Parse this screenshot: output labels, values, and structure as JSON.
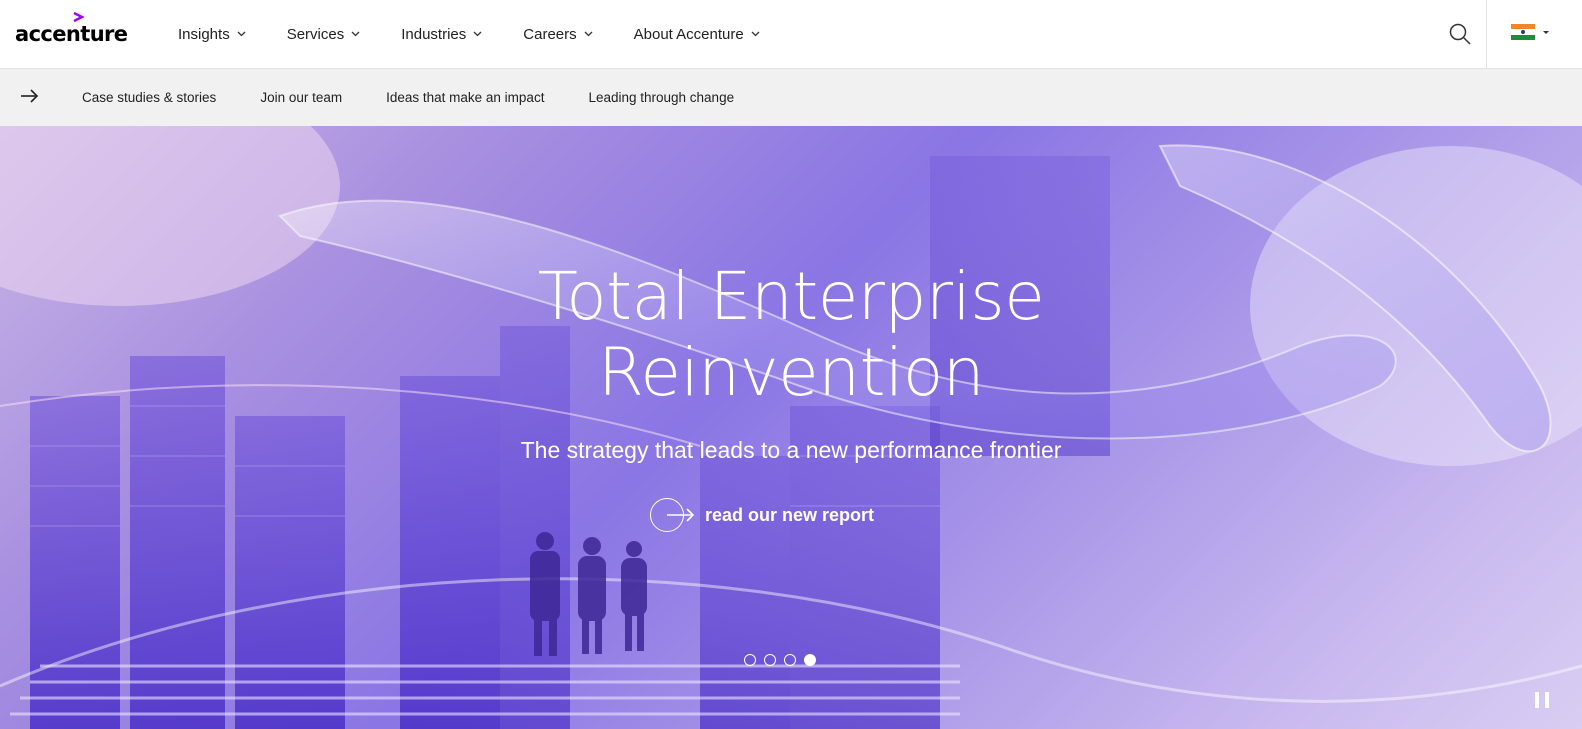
{
  "brand": {
    "name": "accenture",
    "accent_color": "#a100ff"
  },
  "nav": {
    "items": [
      {
        "label": "Insights",
        "icon": "chevron-down-icon"
      },
      {
        "label": "Services",
        "icon": "chevron-down-icon"
      },
      {
        "label": "Industries",
        "icon": "chevron-down-icon"
      },
      {
        "label": "Careers",
        "icon": "chevron-down-icon"
      },
      {
        "label": "About Accenture",
        "icon": "chevron-down-icon"
      }
    ],
    "search_icon": "search-icon",
    "locale_icon": "india-flag-icon"
  },
  "subnav": {
    "arrow_icon": "arrow-right-icon",
    "links": [
      "Case studies & stories",
      "Join our team",
      "Ideas that make an impact",
      "Leading through change"
    ]
  },
  "hero": {
    "title_line1": "Total Enterprise",
    "title_line2": "Reinvention",
    "subtitle": "The strategy that leads to a new performance frontier",
    "cta_label": "read our new report",
    "cta_icon": "arrow-circle-icon",
    "carousel": {
      "slide_count": 4,
      "active_slide": 4
    },
    "pause_icon": "pause-icon"
  }
}
